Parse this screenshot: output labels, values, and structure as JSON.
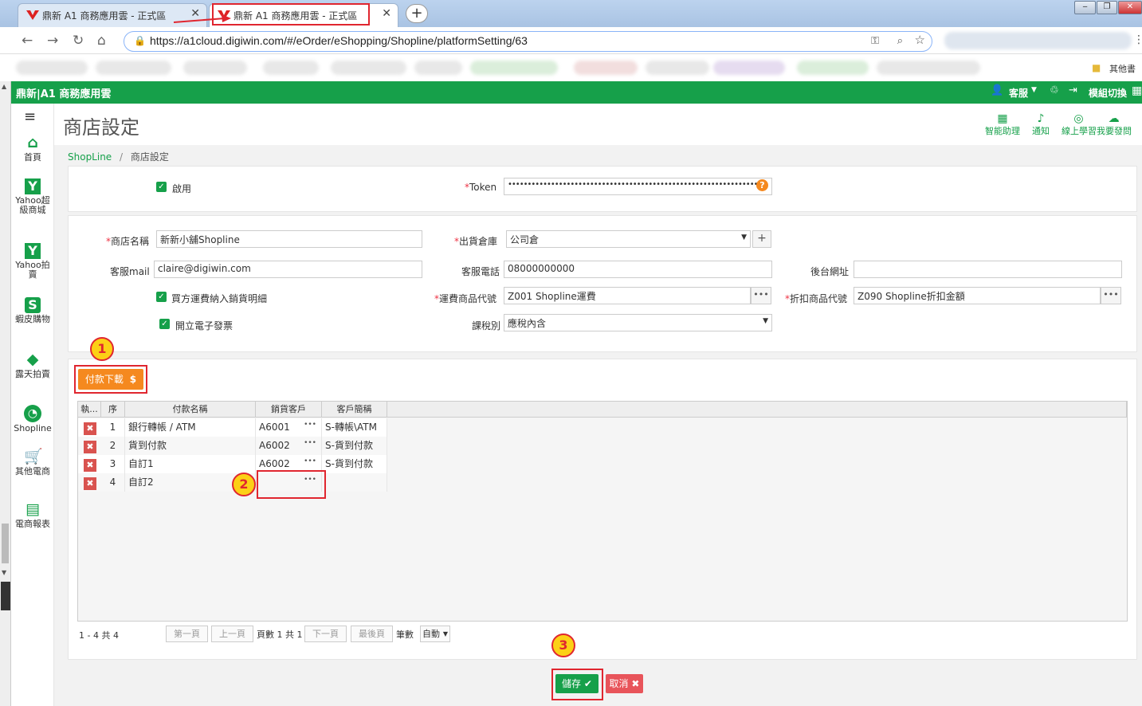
{
  "browser": {
    "tabs": [
      {
        "title": "鼎新 A1 商務應用雲 - 正式區",
        "active": false
      },
      {
        "title": "鼎新 A1 商務應用雲 - 正式區",
        "active": true
      }
    ],
    "url": "https://a1cloud.digiwin.com/#/eOrder/eShopping/Shopline/platformSetting/63",
    "bookmarks_other": "其他書"
  },
  "app": {
    "brand": "鼎新|A1 商務應用雲",
    "header_right": {
      "service": "客服",
      "module_switch": "模組切換"
    },
    "page_title": "商店設定",
    "tools": [
      "智能助理",
      "通知",
      "線上學習我要發問"
    ],
    "breadcrumb": {
      "root": "ShopLine",
      "separator": "/",
      "current": "商店設定"
    }
  },
  "sidebar": [
    {
      "icon": "home-icon",
      "label": "首頁"
    },
    {
      "icon": "yahoo-icon",
      "label": "Yahoo超級商城"
    },
    {
      "icon": "yahoo-icon",
      "label": "Yahoo拍賣"
    },
    {
      "icon": "shopee-icon",
      "label": "蝦皮購物"
    },
    {
      "icon": "ruten-icon",
      "label": "露天拍賣"
    },
    {
      "icon": "shopline-icon",
      "label": "Shopline"
    },
    {
      "icon": "cart-icon",
      "label": "其他電商"
    },
    {
      "icon": "report-icon",
      "label": "電商報表"
    }
  ],
  "form": {
    "enable_label": "啟用",
    "token_label": "Token",
    "token_value": "••••••••••••••••••••••••••••••••••••••••••••••••••••••••••••••••",
    "shop_name_label": "商店名稱",
    "shop_name": "新新小舖Shopline",
    "warehouse_label": "出貨倉庫",
    "warehouse": "公司倉",
    "service_mail_label": "客服mail",
    "service_mail": "claire@digiwin.com",
    "service_phone_label": "客服電話",
    "service_phone": "08000000000",
    "backend_url_label": "後台網址",
    "backend_url": "",
    "freight_include_label": "買方運費納入銷貨明細",
    "freight_code_label": "運費商品代號",
    "freight_code": "Z001 Shopline運費",
    "discount_code_label": "折扣商品代號",
    "discount_code": "Z090 Shopline折扣金額",
    "invoice_label": "開立電子發票",
    "tax_label": "課稅別",
    "tax": "應稅內含"
  },
  "payment": {
    "download_button": "付款下載",
    "headers": [
      "執...",
      "序",
      "付款名稱",
      "銷貨客戶",
      "客戶簡稱"
    ],
    "rows": [
      {
        "seq": "1",
        "name": "銀行轉帳 / ATM",
        "customer": "A6001",
        "short": "S-轉帳\\ATM"
      },
      {
        "seq": "2",
        "name": "貨到付款",
        "customer": "A6002",
        "short": "S-貨到付款"
      },
      {
        "seq": "3",
        "name": "自訂1",
        "customer": "A6002",
        "short": "S-貨到付款"
      },
      {
        "seq": "4",
        "name": "自訂2",
        "customer": "",
        "short": ""
      }
    ],
    "pager": {
      "summary": "1 - 4 共 4",
      "first": "第一頁",
      "prev": "上一頁",
      "page_info": "頁數 1 共 1",
      "next": "下一頁",
      "last": "最後頁",
      "size_label": "筆數",
      "size_value": "自動"
    }
  },
  "actions": {
    "save": "儲存",
    "cancel": "取消"
  },
  "annotations": [
    "1",
    "2",
    "3"
  ],
  "colors": {
    "brand_green": "#16a04a",
    "annotation_red": "#e0262f",
    "download_orange": "#f5891f",
    "annotation_yellow": "#fcd016"
  }
}
